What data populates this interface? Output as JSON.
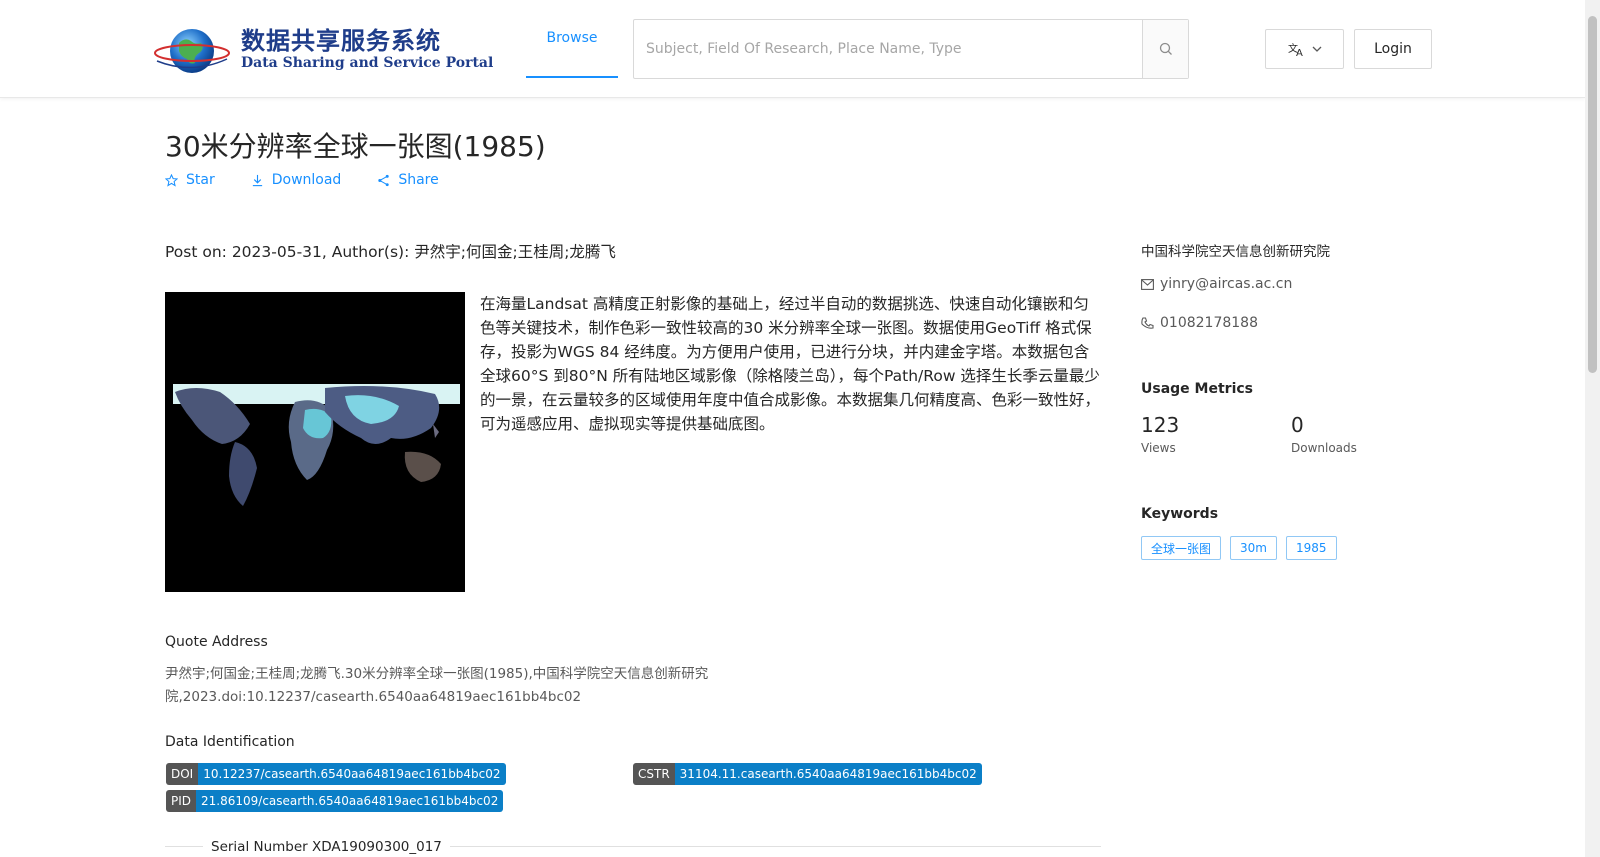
{
  "header": {
    "logo_cn": "数据共享服务系统",
    "logo_en": "Data Sharing and Service Portal",
    "nav_browse": "Browse",
    "search_placeholder": "Subject, Field Of Research, Place Name, Type",
    "login": "Login"
  },
  "dataset": {
    "title": "30米分辨率全球一张图(1985)",
    "actions": {
      "star": "Star",
      "download": "Download",
      "share": "Share"
    },
    "post_on": "Post on: 2023-05-31, Author(s): 尹然宇;何国金;王桂周;龙腾飞",
    "description": "在海量Landsat 高精度正射影像的基础上，经过半自动的数据挑选、快速自动化镶嵌和匀色等关键技术，制作色彩一致性较高的30 米分辨率全球一张图。数据使用GeoTiff 格式保存，投影为WGS 84 经纬度。为方便用户使用，已进行分块，并内建金字塔。本数据包含全球60°S 到80°N 所有陆地区域影像（除格陵兰岛），每个Path/Row 选择生长季云量最少的一景，在云量较多的区域使用年度中值合成影像。本数据集几何精度高、色彩一致性好，可为遥感应用、虚拟现实等提供基础底图。",
    "quote_label": "Quote Address",
    "quote_text": "尹然宇;何国金;王桂周;龙腾飞.30米分辨率全球一张图(1985),中国科学院空天信息创新研究院,2023.doi:10.12237/casearth.6540aa64819aec161bb4bc02",
    "id_label": "Data Identification",
    "ids": {
      "doi_key": "DOI",
      "doi_val": "10.12237/casearth.6540aa64819aec161bb4bc02",
      "cstr_key": "CSTR",
      "cstr_val": "31104.11.casearth.6540aa64819aec161bb4bc02",
      "pid_key": "PID",
      "pid_val": "21.86109/casearth.6540aa64819aec161bb4bc02"
    },
    "serial": "Serial Number XDA19090300_017"
  },
  "sidebar": {
    "org": "中国科学院空天信息创新研究院",
    "email": "yinry@aircas.ac.cn",
    "phone": "01082178188",
    "metrics_title": "Usage Metrics",
    "views_num": "123",
    "views_label": "Views",
    "downloads_num": "0",
    "downloads_label": "Downloads",
    "keywords_title": "Keywords",
    "keywords": [
      "全球一张图",
      "30m",
      "1985"
    ]
  },
  "colors": {
    "accent": "#1890ff",
    "badge_key": "#555555",
    "badge_val": "#0b7fc7"
  }
}
